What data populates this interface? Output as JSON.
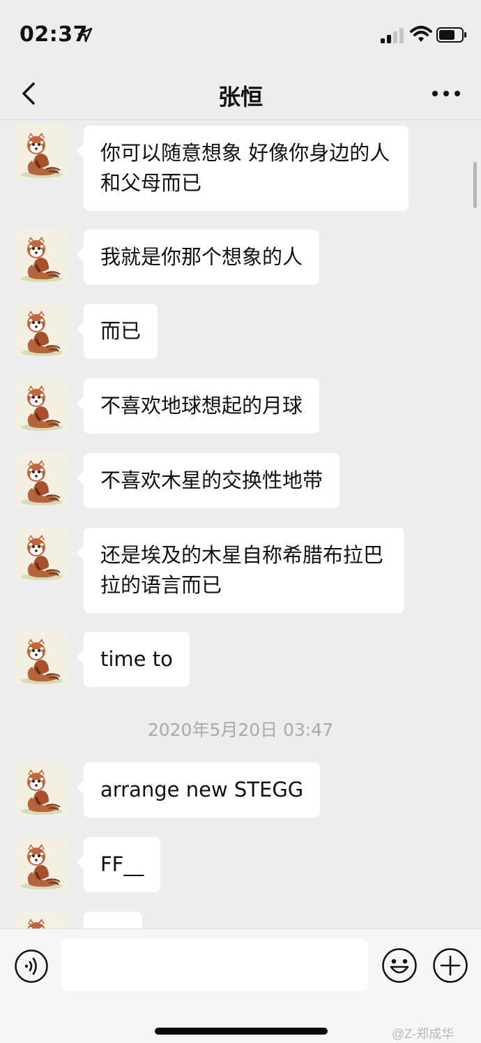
{
  "status": {
    "time": "02:37"
  },
  "nav": {
    "title": "张恒"
  },
  "messages": [
    {
      "text": "你可以随意想象 好像你身边的人和父母而已"
    },
    {
      "text": "我就是你那个想象的人"
    },
    {
      "text": "而已"
    },
    {
      "text": "不喜欢地球想起的月球"
    },
    {
      "text": "不喜欢木星的交换性地带"
    },
    {
      "text": "还是埃及的木星自称希腊布拉巴拉的语言而已"
    },
    {
      "text": "time to"
    },
    {
      "text": "arrange new STEGG"
    },
    {
      "text": "FF__"
    },
    {
      "text": ""
    }
  ],
  "timestamp": "2020年5月20日 03:47",
  "input": {
    "value": ""
  },
  "watermark": "@Z-郑成华",
  "icons": {
    "location": "location-arrow-icon",
    "signal": "cellular-signal-icon",
    "wifi": "wifi-icon",
    "battery": "battery-icon",
    "back": "chevron-left-icon",
    "more": "more-dots-icon",
    "voice": "voice-icon",
    "emoji": "emoji-icon",
    "plus": "plus-icon",
    "avatar": "red-panda-avatar"
  },
  "colors": {
    "background": "#ededed",
    "bubble": "#ffffff",
    "timestamp": "#a9a9a9",
    "input_bar": "#f6f6f6"
  }
}
